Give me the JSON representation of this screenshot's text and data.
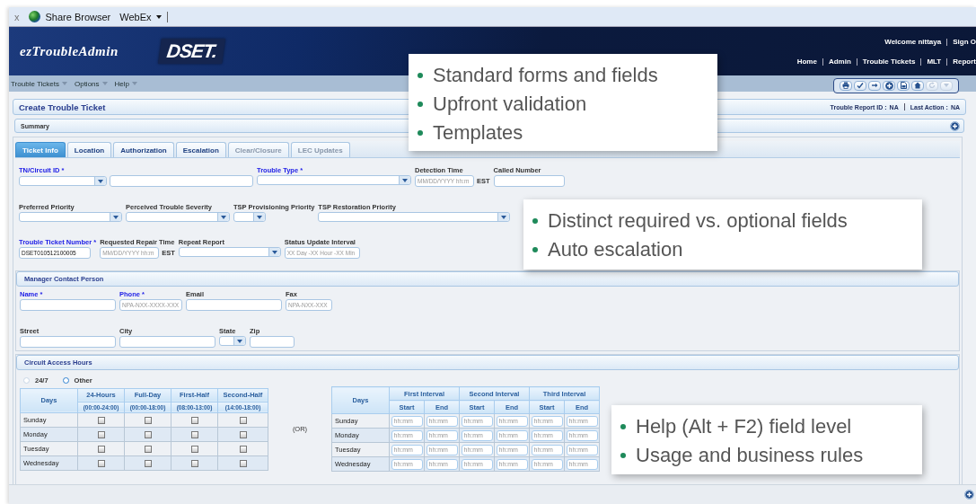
{
  "browser_bar": {
    "close": "x",
    "title": "Share Browser",
    "menu": "WebEx"
  },
  "header": {
    "app_name": "ezTroubleAdmin",
    "logo": "DSET.",
    "welcome": "Welcome nittaya",
    "sign_out": "Sign O",
    "nav": [
      "Home",
      "Admin",
      "Trouble Tickets",
      "MLT",
      "Report"
    ]
  },
  "menu": [
    "Trouble Tickets",
    "Options",
    "Help"
  ],
  "toolbar": [
    {
      "kind": "print",
      "disabled": false
    },
    {
      "kind": "check",
      "disabled": false
    },
    {
      "kind": "arrow",
      "disabled": false
    },
    {
      "kind": "add",
      "disabled": false
    },
    {
      "kind": "document",
      "disabled": false
    },
    {
      "kind": "home",
      "disabled": false
    },
    {
      "kind": "refresh",
      "disabled": true
    },
    {
      "kind": "dropdown",
      "disabled": true
    }
  ],
  "title_bar": {
    "title": "Create Trouble Ticket",
    "report_id_label": "Trouble Report ID :",
    "report_id": "NA",
    "last_action_label": "Last Action :",
    "last_action": "NA"
  },
  "summary": "Summary",
  "tabs": [
    {
      "label": "Ticket Info",
      "selected": true,
      "disabled": false
    },
    {
      "label": "Location",
      "selected": false,
      "disabled": false
    },
    {
      "label": "Authorization",
      "selected": false,
      "disabled": false
    },
    {
      "label": "Escalation",
      "selected": false,
      "disabled": false
    },
    {
      "label": "Clear/Closure",
      "selected": false,
      "disabled": true
    },
    {
      "label": "LEC Updates",
      "selected": false,
      "disabled": true
    }
  ],
  "ticket_rows": [
    [
      {
        "label": "TN/Circuit ID *",
        "required": true,
        "kind": "combo"
      },
      {
        "label": "Trouble Type *",
        "required": true,
        "kind": "select"
      },
      {
        "label": "Detection Time",
        "required": false,
        "kind": "text",
        "placeholder": "MM/DD/YYYY hh:m",
        "suffix": "EST"
      },
      {
        "label": "Called Number",
        "required": false,
        "kind": "text"
      }
    ],
    [
      {
        "label": "Preferred Priority",
        "required": false,
        "kind": "select"
      },
      {
        "label": "Perceived Trouble  Severity",
        "required": false,
        "kind": "select"
      },
      {
        "label": "TSP Provisioning Priority",
        "required": false,
        "kind": "select"
      },
      {
        "label": "TSP Restoration Priority",
        "required": false,
        "kind": "select"
      }
    ],
    [
      {
        "label": "Trouble Ticket Number *",
        "required": true,
        "kind": "text",
        "value": "DSET010512100005"
      },
      {
        "label": "Requested Repair Time",
        "required": false,
        "kind": "text",
        "placeholder": "MM/DD/YYYY hh:m",
        "suffix": "EST"
      },
      {
        "label": "Repeat Report",
        "required": false,
        "kind": "select"
      },
      {
        "label": "Status Update Interval",
        "required": false,
        "kind": "text",
        "placeholder": "XX Day -XX Hour -XX Min"
      }
    ]
  ],
  "manager_contact": {
    "title": "Manager Contact Person",
    "rows": [
      [
        {
          "label": "Name *",
          "required": true,
          "kind": "text"
        },
        {
          "label": "Phone *",
          "required": true,
          "kind": "text",
          "placeholder": "NPA-NXX-XXXX-XXX"
        },
        {
          "label": "Email",
          "required": false,
          "kind": "text"
        },
        {
          "label": "Fax",
          "required": false,
          "kind": "text",
          "placeholder": "NPA-NXX-XXX"
        }
      ],
      [
        {
          "label": "Street",
          "required": false,
          "kind": "text"
        },
        {
          "label": "City",
          "required": false,
          "kind": "text"
        },
        {
          "label": "State",
          "required": false,
          "kind": "select"
        },
        {
          "label": "Zip",
          "required": false,
          "kind": "text"
        }
      ]
    ]
  },
  "access_hours": {
    "title": "Circuit Access Hours",
    "options": [
      {
        "label": "24/7",
        "selected": false
      },
      {
        "label": "Other",
        "selected": true
      }
    ],
    "shift_table": {
      "day_header": "Days",
      "columns": [
        {
          "label": "24-Hours",
          "range": "(00:00-24:00)"
        },
        {
          "label": "Full-Day",
          "range": "(00:00-18:00)"
        },
        {
          "label": "First-Half",
          "range": "(08:00-13:00)"
        },
        {
          "label": "Second-Half",
          "range": "(14:00-18:00)"
        }
      ],
      "rows": [
        {
          "day": "Sunday",
          "checks": [
            false,
            false,
            false,
            false
          ]
        },
        {
          "day": "Monday",
          "checks": [
            false,
            false,
            false,
            false
          ]
        },
        {
          "day": "Tuesday",
          "checks": [
            false,
            false,
            false,
            false
          ]
        },
        {
          "day": "Wednesday",
          "checks": [
            false,
            false,
            false,
            false
          ]
        }
      ]
    },
    "separator": "(OR)",
    "interval_table": {
      "day_header": "Days",
      "intervals": [
        {
          "label": "First Interval",
          "columns": [
            "Start",
            "End"
          ]
        },
        {
          "label": "Second Interval",
          "columns": [
            "Start",
            "End"
          ]
        },
        {
          "label": "Third Interval",
          "columns": [
            "Start",
            "End"
          ]
        }
      ],
      "rows": [
        {
          "day": "Sunday",
          "placeholders": [
            "hh:mm",
            "hh:mm",
            "hh:mm",
            "hh:mm",
            "hh:mm",
            "hh:mm"
          ]
        },
        {
          "day": "Monday",
          "placeholders": [
            "hh:mm",
            "hh:mm",
            "hh:mm",
            "hh:mm",
            "hh:mm",
            "hh:mm"
          ]
        },
        {
          "day": "Tuesday",
          "placeholders": [
            "hh:mm",
            "hh:mm",
            "hh:mm",
            "hh:mm",
            "hh:mm",
            "hh:mm"
          ]
        },
        {
          "day": "Wednesday",
          "placeholders": [
            "hh:mm",
            "hh:mm",
            "hh:mm",
            "hh:mm",
            "hh:mm",
            "hh:mm"
          ]
        }
      ]
    }
  },
  "callouts": [
    {
      "items": [
        "Standard forms and fields",
        "Upfront validation",
        "Templates"
      ]
    },
    {
      "items": [
        "Distinct required vs. optional fields",
        "Auto escalation"
      ]
    },
    {
      "items": [
        "Help (Alt + F2) field level",
        "Usage and business rules"
      ]
    }
  ]
}
